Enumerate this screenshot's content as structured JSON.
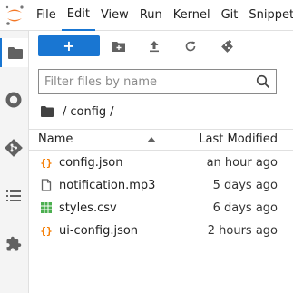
{
  "colors": {
    "accent": "#1976d2",
    "logo_orange": "#f37726",
    "json_icon": "#f57c00",
    "csv_icon": "#4caf50",
    "icon_gray": "#616161"
  },
  "menubar": {
    "items": [
      "File",
      "Edit",
      "View",
      "Run",
      "Kernel",
      "Git",
      "Snippets"
    ],
    "active": "Edit"
  },
  "sidebar": {
    "icons": [
      "folder-icon",
      "running-icon",
      "git-icon",
      "toc-icon",
      "extension-icon"
    ],
    "active": "folder-icon"
  },
  "toolbar": {
    "new_label": "+",
    "icons": [
      "new-folder-icon",
      "upload-icon",
      "refresh-icon",
      "git-clone-icon"
    ]
  },
  "filter": {
    "placeholder": "Filter files by name",
    "value": ""
  },
  "breadcrumb": {
    "sep1": "/",
    "folder": "config",
    "sep2": "/"
  },
  "table": {
    "name_header": "Name",
    "modified_header": "Last Modified",
    "sort": "ascending"
  },
  "files": [
    {
      "name": "config.json",
      "modified": "an hour ago",
      "type": "json"
    },
    {
      "name": "notification.mp3",
      "modified": "5 days ago",
      "type": "file"
    },
    {
      "name": "styles.csv",
      "modified": "6 days ago",
      "type": "csv"
    },
    {
      "name": "ui-config.json",
      "modified": "2 hours ago",
      "type": "json"
    }
  ]
}
